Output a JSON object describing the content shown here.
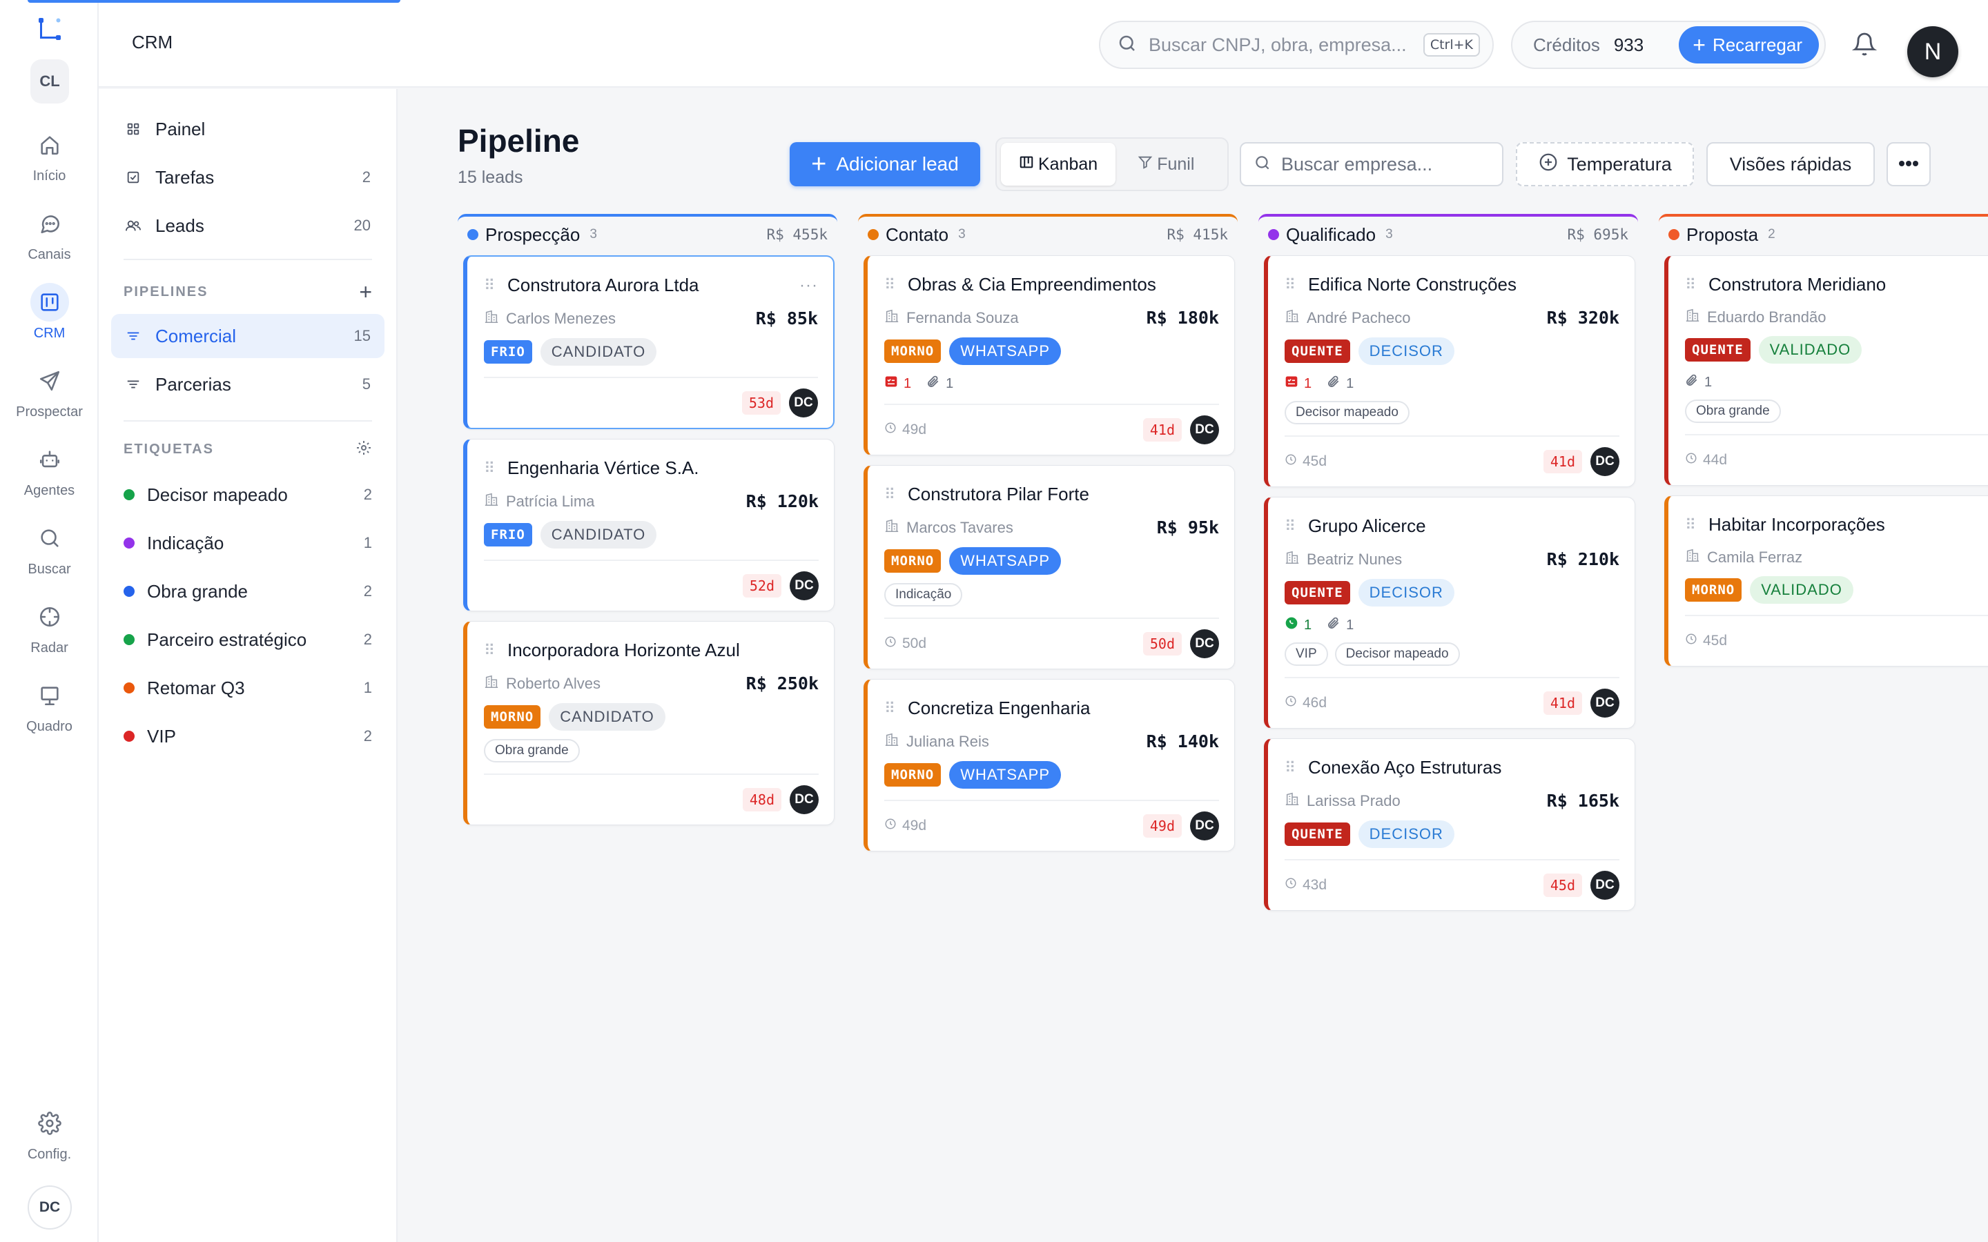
{
  "app": {
    "section_title": "CRM",
    "workspace_initials": "CL",
    "user_initial": "N",
    "footer_avatar_initials": "DC"
  },
  "rail": [
    {
      "label": "Início",
      "icon": "home-icon",
      "active": false
    },
    {
      "label": "Canais",
      "icon": "chat-bubble-icon",
      "active": false
    },
    {
      "label": "CRM",
      "icon": "kanban-icon",
      "active": true
    },
    {
      "label": "Prospectar",
      "icon": "send-icon",
      "active": false
    },
    {
      "label": "Agentes",
      "icon": "bot-icon",
      "active": false
    },
    {
      "label": "Buscar",
      "icon": "search-icon",
      "active": false
    },
    {
      "label": "Radar",
      "icon": "crosshair-icon",
      "active": false
    },
    {
      "label": "Quadro",
      "icon": "presentation-icon",
      "active": false
    }
  ],
  "rail_settings_label": "Config.",
  "header": {
    "search_placeholder": "Buscar CNPJ, obra, empresa...",
    "shortcut": "Ctrl+K",
    "credits_label": "Créditos",
    "credits_value": "933",
    "recharge_label": "Recarregar"
  },
  "sidebar": {
    "nav": [
      {
        "label": "Painel",
        "count": ""
      },
      {
        "label": "Tarefas",
        "count": "2"
      },
      {
        "label": "Leads",
        "count": "20"
      }
    ],
    "pipelines_title": "PIPELINES",
    "pipelines": [
      {
        "label": "Comercial",
        "count": "15",
        "active": true
      },
      {
        "label": "Parcerias",
        "count": "5",
        "active": false
      }
    ],
    "tags_title": "ETIQUETAS",
    "tags": [
      {
        "label": "Decisor mapeado",
        "count": "2",
        "color": "#16a34a"
      },
      {
        "label": "Indicação",
        "count": "1",
        "color": "#9333ea"
      },
      {
        "label": "Obra grande",
        "count": "2",
        "color": "#2563eb"
      },
      {
        "label": "Parceiro estratégico",
        "count": "2",
        "color": "#16a34a"
      },
      {
        "label": "Retomar Q3",
        "count": "1",
        "color": "#ea580c"
      },
      {
        "label": "VIP",
        "count": "2",
        "color": "#dc2626"
      }
    ]
  },
  "page": {
    "title": "Pipeline",
    "subtitle": "15 leads",
    "add_lead_label": "Adicionar lead",
    "view_kanban": "Kanban",
    "view_funnel": "Funil",
    "company_search_placeholder": "Buscar empresa...",
    "temperature_label": "Temperatura",
    "quick_views_label": "Visões rápidas"
  },
  "colors": {
    "accent": "#3b82f6",
    "frio": "#3b82f6",
    "morno": "#e8780c",
    "quente": "#c2261d"
  },
  "columns": [
    {
      "name": "Prospecção",
      "count": "3",
      "total": "R$ 455k",
      "color": "#3b82f6",
      "cards": [
        {
          "title": "Construtora Aurora Ltda",
          "contact": "Carlos Menezes",
          "value": "R$ 85k",
          "temp": "FRIO",
          "temp_color": "#3b82f6",
          "status": "CANDIDATO",
          "status_style": "gray",
          "tasks": "",
          "attachments": "",
          "whatsapp": "",
          "tags": [],
          "since": "",
          "age": "53d",
          "owner": "DC",
          "selected": true
        },
        {
          "title": "Engenharia Vértice S.A.",
          "contact": "Patrícia Lima",
          "value": "R$ 120k",
          "temp": "FRIO",
          "temp_color": "#3b82f6",
          "status": "CANDIDATO",
          "status_style": "gray",
          "tasks": "",
          "attachments": "",
          "whatsapp": "",
          "tags": [],
          "since": "",
          "age": "52d",
          "owner": "DC",
          "selected": false
        },
        {
          "title": "Incorporadora Horizonte Azul",
          "contact": "Roberto Alves",
          "value": "R$ 250k",
          "temp": "MORNO",
          "temp_color": "#e8780c",
          "status": "CANDIDATO",
          "status_style": "gray",
          "tasks": "",
          "attachments": "",
          "whatsapp": "",
          "tags": [
            "Obra grande"
          ],
          "since": "",
          "age": "48d",
          "owner": "DC",
          "selected": false
        }
      ]
    },
    {
      "name": "Contato",
      "count": "3",
      "total": "R$ 415k",
      "color": "#e8780c",
      "cards": [
        {
          "title": "Obras & Cia Empreendimentos",
          "contact": "Fernanda Souza",
          "value": "R$ 180k",
          "temp": "MORNO",
          "temp_color": "#e8780c",
          "status": "WHATSAPP",
          "status_style": "whatsapp",
          "tasks": "1",
          "attachments": "1",
          "whatsapp": "",
          "tags": [],
          "since": "49d",
          "age": "41d",
          "owner": "DC",
          "selected": false
        },
        {
          "title": "Construtora Pilar Forte",
          "contact": "Marcos Tavares",
          "value": "R$ 95k",
          "temp": "MORNO",
          "temp_color": "#e8780c",
          "status": "WHATSAPP",
          "status_style": "whatsapp",
          "tasks": "",
          "attachments": "",
          "whatsapp": "",
          "tags": [
            "Indicação"
          ],
          "since": "50d",
          "age": "50d",
          "owner": "DC",
          "selected": false
        },
        {
          "title": "Concretiza Engenharia",
          "contact": "Juliana Reis",
          "value": "R$ 140k",
          "temp": "MORNO",
          "temp_color": "#e8780c",
          "status": "WHATSAPP",
          "status_style": "whatsapp",
          "tasks": "",
          "attachments": "",
          "whatsapp": "",
          "tags": [],
          "since": "49d",
          "age": "49d",
          "owner": "DC",
          "selected": false
        }
      ]
    },
    {
      "name": "Qualificado",
      "count": "3",
      "total": "R$ 695k",
      "color": "#9333ea",
      "cards": [
        {
          "title": "Edifica Norte Construções",
          "contact": "André Pacheco",
          "value": "R$ 320k",
          "temp": "QUENTE",
          "temp_color": "#c2261d",
          "status": "DECISOR",
          "status_style": "decisor",
          "tasks": "1",
          "attachments": "1",
          "whatsapp": "",
          "tags": [
            "Decisor mapeado"
          ],
          "since": "45d",
          "age": "41d",
          "owner": "DC",
          "selected": false
        },
        {
          "title": "Grupo Alicerce",
          "contact": "Beatriz Nunes",
          "value": "R$ 210k",
          "temp": "QUENTE",
          "temp_color": "#c2261d",
          "status": "DECISOR",
          "status_style": "decisor",
          "tasks": "",
          "attachments": "1",
          "whatsapp": "1",
          "tags": [
            "VIP",
            "Decisor mapeado"
          ],
          "since": "46d",
          "age": "41d",
          "owner": "DC",
          "selected": false
        },
        {
          "title": "Conexão Aço Estruturas",
          "contact": "Larissa Prado",
          "value": "R$ 165k",
          "temp": "QUENTE",
          "temp_color": "#c2261d",
          "status": "DECISOR",
          "status_style": "decisor",
          "tasks": "",
          "attachments": "",
          "whatsapp": "",
          "tags": [],
          "since": "43d",
          "age": "45d",
          "owner": "DC",
          "selected": false
        }
      ]
    },
    {
      "name": "Proposta",
      "count": "2",
      "total": "",
      "color": "#f05a28",
      "cards": [
        {
          "title": "Construtora Meridiano",
          "contact": "Eduardo Brandão",
          "value": "",
          "temp": "QUENTE",
          "temp_color": "#c2261d",
          "status": "VALIDADO",
          "status_style": "validado",
          "tasks": "",
          "attachments": "1",
          "whatsapp": "",
          "tags": [
            "Obra grande"
          ],
          "since": "44d",
          "age": "",
          "owner": "",
          "selected": false
        },
        {
          "title": "Habitar Incorporações",
          "contact": "Camila Ferraz",
          "value": "",
          "temp": "MORNO",
          "temp_color": "#e8780c",
          "status": "VALIDADO",
          "status_style": "validado",
          "tasks": "",
          "attachments": "",
          "whatsapp": "",
          "tags": [],
          "since": "45d",
          "age": "",
          "owner": "",
          "selected": false
        }
      ]
    }
  ]
}
